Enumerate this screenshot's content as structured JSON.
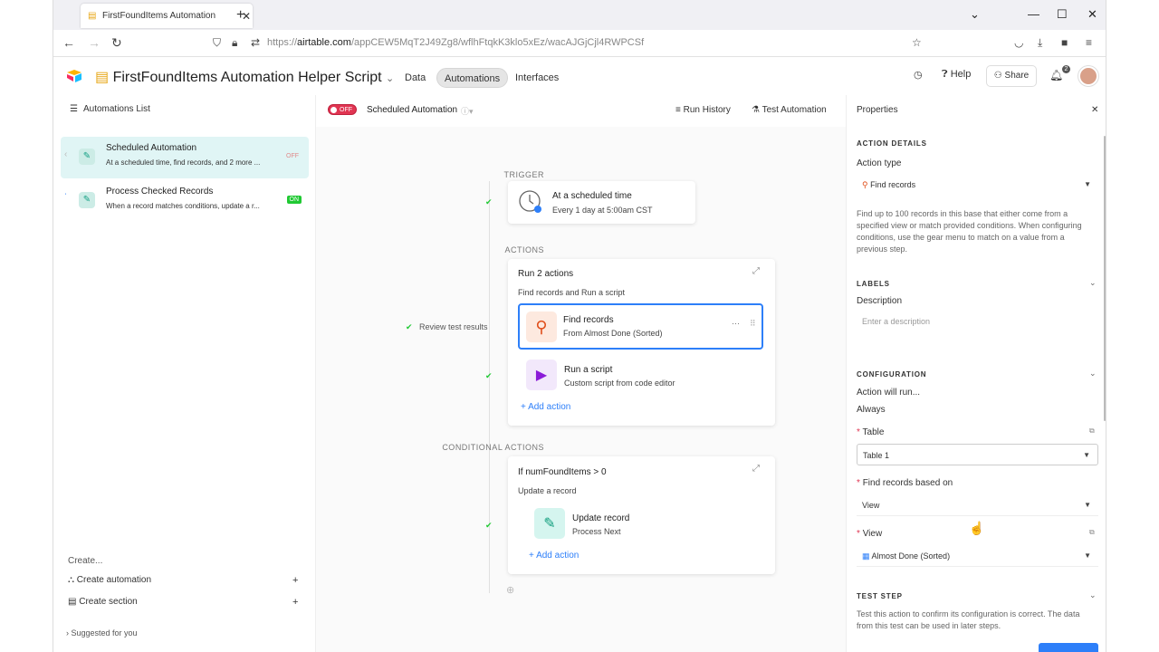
{
  "browser": {
    "tab_title": "FirstFoundItems Automation",
    "url_prefix": "https://",
    "url_domain": "airtable.com",
    "url_path": "/appCEW5MqT2J49Zg8/wflhFtqkK3klo5xEz/wacAJGjCjl4RWPCSf"
  },
  "header": {
    "base_title": "FirstFoundItems Automation Helper Script",
    "nav": [
      "Data",
      "Automations",
      "Interfaces"
    ],
    "help": "Help",
    "share": "Share",
    "notifications": "2"
  },
  "left": {
    "list_title": "Automations List",
    "automations": [
      {
        "name": "Scheduled Automation",
        "desc": "At a scheduled time, find records, and 2 more ...",
        "status": "OFF"
      },
      {
        "name": "Process Checked Records",
        "desc": "When a record matches conditions, update a r...",
        "status": "ON"
      }
    ],
    "create_label": "Create...",
    "create_automation": "Create automation",
    "create_section": "Create section",
    "suggested": "Suggested for you"
  },
  "toolbar": {
    "toggle": "OFF",
    "automation_name": "Scheduled Automation",
    "run_history": "Run History",
    "test_automation": "Test Automation"
  },
  "canvas": {
    "trigger_label": "TRIGGER",
    "trigger_title": "At a scheduled time",
    "trigger_sub": "Every 1 day at 5:00am CST",
    "actions_label": "ACTIONS",
    "group_title": "Run 2 actions",
    "group_sub": "Find records and Run a script",
    "review": "Review test results",
    "action1_title": "Find records",
    "action1_sub": "From Almost Done (Sorted)",
    "action2_title": "Run a script",
    "action2_sub": "Custom script from code editor",
    "add_action": "Add action",
    "cond_label": "CONDITIONAL ACTIONS",
    "cond_title": "If numFoundItems > 0",
    "cond_sub": "Update a record",
    "cond_action_title": "Update record",
    "cond_action_sub": "Process Next"
  },
  "properties": {
    "title": "Properties",
    "action_details": "ACTION DETAILS",
    "action_type_label": "Action type",
    "action_type": "Find records",
    "description_text": "Find up to 100 records in this base that either come from a specified view or match provided conditions. When configuring conditions, use the gear menu to match on a value from a previous step.",
    "labels": "LABELS",
    "description_label": "Description",
    "description_placeholder": "Enter a description",
    "configuration": "CONFIGURATION",
    "will_run": "Action will run...",
    "always": "Always",
    "table_label": "Table",
    "table_value": "Table 1",
    "find_based_label": "Find records based on",
    "find_based_value": "View",
    "view_label": "View",
    "view_value": "Almost Done (Sorted)",
    "test_step": "TEST STEP",
    "test_text": "Test this action to confirm its configuration is correct. The data from this test can be used in later steps."
  },
  "colors": {
    "accent": "#2d7ff9",
    "off": "#e03552",
    "on": "#20c933"
  }
}
